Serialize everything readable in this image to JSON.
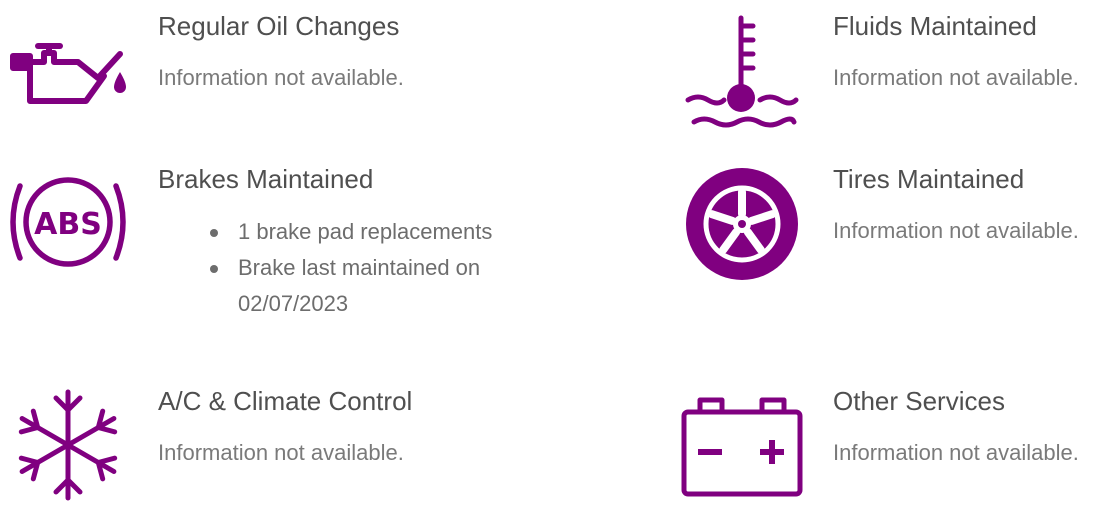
{
  "theme": {
    "accent": "#800080",
    "title_color": "#4f4f4f",
    "text_color": "#7a7a7a"
  },
  "services": [
    {
      "id": "oil",
      "icon": "oil-can-icon",
      "title": "Regular Oil Changes",
      "description": "Information not available."
    },
    {
      "id": "fluids",
      "icon": "coolant-temperature-icon",
      "title": "Fluids Maintained",
      "description": "Information not available."
    },
    {
      "id": "brakes",
      "icon": "abs-brake-icon",
      "title": "Brakes Maintained",
      "details": [
        "1 brake pad replacements",
        "Brake last maintained on 02/07/2023"
      ]
    },
    {
      "id": "tires",
      "icon": "tire-wheel-icon",
      "title": "Tires Maintained",
      "description": "Information not available."
    },
    {
      "id": "climate",
      "icon": "snowflake-icon",
      "title": "A/C & Climate Control",
      "description": "Information not available."
    },
    {
      "id": "other",
      "icon": "battery-icon",
      "title": "Other Services",
      "description": "Information not available."
    }
  ]
}
